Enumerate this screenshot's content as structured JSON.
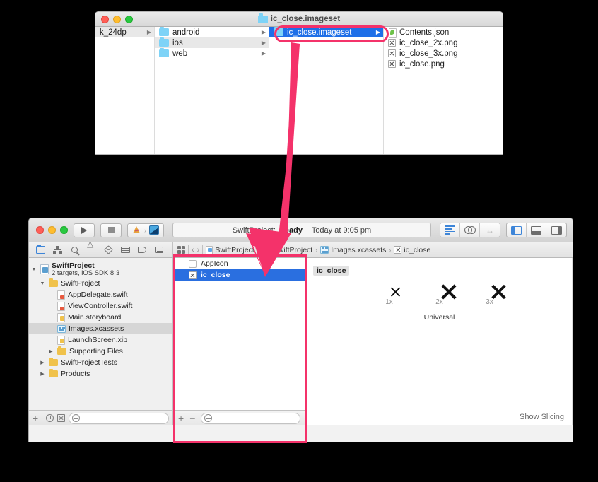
{
  "finder": {
    "title": "ic_close.imageset",
    "title_icon": "folder-icon",
    "columns": [
      {
        "name": "column-1",
        "items": [
          {
            "label": "k_24dp",
            "icon": "none",
            "state": "grey",
            "chevron": "▶"
          }
        ]
      },
      {
        "name": "column-2",
        "items": [
          {
            "label": "android",
            "icon": "folder-icon",
            "state": "normal",
            "chevron": "▶"
          },
          {
            "label": "ios",
            "icon": "folder-icon",
            "state": "grey",
            "chevron": "▶"
          },
          {
            "label": "web",
            "icon": "folder-icon",
            "state": "normal",
            "chevron": "▶"
          }
        ]
      },
      {
        "name": "column-3",
        "items": [
          {
            "label": "ic_close.imageset",
            "icon": "folder-icon",
            "state": "selected",
            "chevron": "▶"
          }
        ]
      },
      {
        "name": "column-4",
        "items": [
          {
            "label": "Contents.json",
            "icon": "json-file-icon",
            "state": "normal",
            "chevron": ""
          },
          {
            "label": "ic_close_2x.png",
            "icon": "png-file-icon",
            "state": "normal",
            "chevron": ""
          },
          {
            "label": "ic_close_3x.png",
            "icon": "png-file-icon",
            "state": "normal",
            "chevron": ""
          },
          {
            "label": "ic_close.png",
            "icon": "png-file-icon",
            "state": "normal",
            "chevron": ""
          }
        ]
      }
    ]
  },
  "annotation": {
    "color": "#f4326a",
    "highlight_oval_target": "ic_close.imageset row in Finder",
    "highlight_rect_target": "asset list panel in Xcode",
    "arrow_description": "pink arrow from Finder imageset row down to Xcode asset list"
  },
  "xcode": {
    "toolbar": {
      "run_label": "Run",
      "stop_label": "Stop",
      "scheme_label": "",
      "status_project": "SwiftProject:",
      "status_state": "Ready",
      "status_separator": "|",
      "status_time": "Today at 9:05 pm",
      "editor_buttons": [
        "standard-editor",
        "assistant-editor",
        "version-editor"
      ],
      "view_buttons": [
        "navigator-toggle",
        "debug-area-toggle",
        "utilities-toggle"
      ]
    },
    "navigator_icons": [
      "project-navigator-icon",
      "symbol-navigator-icon",
      "find-navigator-icon",
      "issue-navigator-icon",
      "test-navigator-icon",
      "debug-navigator-icon",
      "breakpoint-navigator-icon",
      "report-navigator-icon"
    ],
    "breadcrumb": {
      "grid_icon": "related-items-icon",
      "back_label": "‹",
      "forward_label": "›",
      "items": [
        {
          "label": "SwiftProject",
          "icon": "project-icon"
        },
        {
          "label": "SwiftProject",
          "icon": "folder-icon"
        },
        {
          "label": "Images.xcassets",
          "icon": "xcassets-icon"
        },
        {
          "label": "ic_close",
          "icon": "imageset-icon"
        }
      ],
      "separator": "›"
    },
    "tree": [
      {
        "label": "SwiftProject",
        "sub": "2 targets, iOS SDK 8.3",
        "indent": 0,
        "twist": "▼",
        "icon": "project-icon",
        "selected": false
      },
      {
        "label": "SwiftProject",
        "sub": "",
        "indent": 1,
        "twist": "▼",
        "icon": "folder-icon",
        "selected": false
      },
      {
        "label": "AppDelegate.swift",
        "sub": "",
        "indent": 2,
        "twist": "",
        "icon": "swift-file-icon",
        "selected": false
      },
      {
        "label": "ViewController.swift",
        "sub": "",
        "indent": 2,
        "twist": "",
        "icon": "swift-file-icon",
        "selected": false
      },
      {
        "label": "Main.storyboard",
        "sub": "",
        "indent": 2,
        "twist": "",
        "icon": "storyboard-icon",
        "selected": false
      },
      {
        "label": "Images.xcassets",
        "sub": "",
        "indent": 2,
        "twist": "",
        "icon": "xcassets-icon",
        "selected": true
      },
      {
        "label": "LaunchScreen.xib",
        "sub": "",
        "indent": 2,
        "twist": "",
        "icon": "xib-icon",
        "selected": false
      },
      {
        "label": "Supporting Files",
        "sub": "",
        "indent": 1,
        "twist": "▶",
        "icon": "folder-icon",
        "selected": false
      },
      {
        "label": "SwiftProjectTests",
        "sub": "",
        "indent": 0,
        "twist": "▶",
        "icon": "folder-icon",
        "selected": false
      },
      {
        "label": "Products",
        "sub": "",
        "indent": 0,
        "twist": "▶",
        "icon": "folder-icon",
        "selected": false
      }
    ],
    "navigator_bottom": {
      "add_label": "+",
      "separator": "|",
      "recent_icon": "clock-icon",
      "modified_icon": "source-control-icon",
      "filter_placeholder": "",
      "filter_value": "",
      "filter_icon": "filter-icon"
    },
    "asset_list": {
      "items": [
        {
          "label": "AppIcon",
          "icon": "appicon-icon",
          "selected": false
        },
        {
          "label": "ic_close",
          "icon": "imageset-icon",
          "selected": true
        }
      ],
      "bottom": {
        "add_label": "+",
        "remove_label": "−",
        "filter_value": "",
        "filter_icon": "filter-icon"
      }
    },
    "detail": {
      "set_name": "ic_close",
      "slots": [
        {
          "scale": "1x",
          "has_image": true,
          "glyph": "x-mark"
        },
        {
          "scale": "2x",
          "has_image": true,
          "glyph": "x-mark"
        },
        {
          "scale": "3x",
          "has_image": true,
          "glyph": "x-mark"
        }
      ],
      "device_label": "Universal",
      "show_slicing_label": "Show Slicing"
    }
  }
}
